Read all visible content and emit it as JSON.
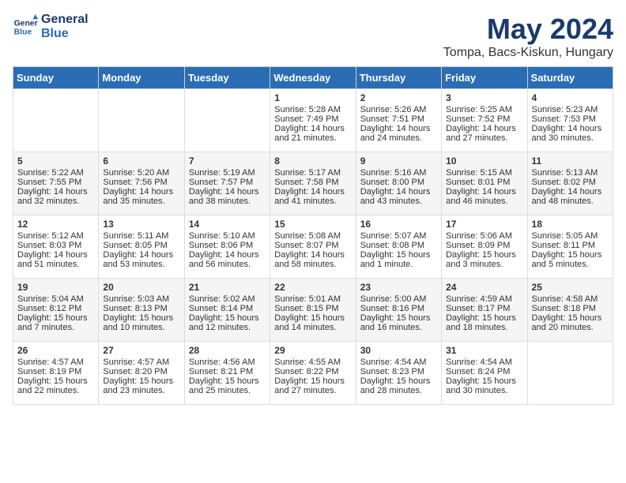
{
  "header": {
    "logo_line1": "General",
    "logo_line2": "Blue",
    "month_year": "May 2024",
    "location": "Tompa, Bacs-Kiskun, Hungary"
  },
  "days_of_week": [
    "Sunday",
    "Monday",
    "Tuesday",
    "Wednesday",
    "Thursday",
    "Friday",
    "Saturday"
  ],
  "weeks": [
    [
      {
        "day": "",
        "content": ""
      },
      {
        "day": "",
        "content": ""
      },
      {
        "day": "",
        "content": ""
      },
      {
        "day": "1",
        "content": "Sunrise: 5:28 AM\nSunset: 7:49 PM\nDaylight: 14 hours\nand 21 minutes."
      },
      {
        "day": "2",
        "content": "Sunrise: 5:26 AM\nSunset: 7:51 PM\nDaylight: 14 hours\nand 24 minutes."
      },
      {
        "day": "3",
        "content": "Sunrise: 5:25 AM\nSunset: 7:52 PM\nDaylight: 14 hours\nand 27 minutes."
      },
      {
        "day": "4",
        "content": "Sunrise: 5:23 AM\nSunset: 7:53 PM\nDaylight: 14 hours\nand 30 minutes."
      }
    ],
    [
      {
        "day": "5",
        "content": "Sunrise: 5:22 AM\nSunset: 7:55 PM\nDaylight: 14 hours\nand 32 minutes."
      },
      {
        "day": "6",
        "content": "Sunrise: 5:20 AM\nSunset: 7:56 PM\nDaylight: 14 hours\nand 35 minutes."
      },
      {
        "day": "7",
        "content": "Sunrise: 5:19 AM\nSunset: 7:57 PM\nDaylight: 14 hours\nand 38 minutes."
      },
      {
        "day": "8",
        "content": "Sunrise: 5:17 AM\nSunset: 7:58 PM\nDaylight: 14 hours\nand 41 minutes."
      },
      {
        "day": "9",
        "content": "Sunrise: 5:16 AM\nSunset: 8:00 PM\nDaylight: 14 hours\nand 43 minutes."
      },
      {
        "day": "10",
        "content": "Sunrise: 5:15 AM\nSunset: 8:01 PM\nDaylight: 14 hours\nand 46 minutes."
      },
      {
        "day": "11",
        "content": "Sunrise: 5:13 AM\nSunset: 8:02 PM\nDaylight: 14 hours\nand 48 minutes."
      }
    ],
    [
      {
        "day": "12",
        "content": "Sunrise: 5:12 AM\nSunset: 8:03 PM\nDaylight: 14 hours\nand 51 minutes."
      },
      {
        "day": "13",
        "content": "Sunrise: 5:11 AM\nSunset: 8:05 PM\nDaylight: 14 hours\nand 53 minutes."
      },
      {
        "day": "14",
        "content": "Sunrise: 5:10 AM\nSunset: 8:06 PM\nDaylight: 14 hours\nand 56 minutes."
      },
      {
        "day": "15",
        "content": "Sunrise: 5:08 AM\nSunset: 8:07 PM\nDaylight: 14 hours\nand 58 minutes."
      },
      {
        "day": "16",
        "content": "Sunrise: 5:07 AM\nSunset: 8:08 PM\nDaylight: 15 hours\nand 1 minute."
      },
      {
        "day": "17",
        "content": "Sunrise: 5:06 AM\nSunset: 8:09 PM\nDaylight: 15 hours\nand 3 minutes."
      },
      {
        "day": "18",
        "content": "Sunrise: 5:05 AM\nSunset: 8:11 PM\nDaylight: 15 hours\nand 5 minutes."
      }
    ],
    [
      {
        "day": "19",
        "content": "Sunrise: 5:04 AM\nSunset: 8:12 PM\nDaylight: 15 hours\nand 7 minutes."
      },
      {
        "day": "20",
        "content": "Sunrise: 5:03 AM\nSunset: 8:13 PM\nDaylight: 15 hours\nand 10 minutes."
      },
      {
        "day": "21",
        "content": "Sunrise: 5:02 AM\nSunset: 8:14 PM\nDaylight: 15 hours\nand 12 minutes."
      },
      {
        "day": "22",
        "content": "Sunrise: 5:01 AM\nSunset: 8:15 PM\nDaylight: 15 hours\nand 14 minutes."
      },
      {
        "day": "23",
        "content": "Sunrise: 5:00 AM\nSunset: 8:16 PM\nDaylight: 15 hours\nand 16 minutes."
      },
      {
        "day": "24",
        "content": "Sunrise: 4:59 AM\nSunset: 8:17 PM\nDaylight: 15 hours\nand 18 minutes."
      },
      {
        "day": "25",
        "content": "Sunrise: 4:58 AM\nSunset: 8:18 PM\nDaylight: 15 hours\nand 20 minutes."
      }
    ],
    [
      {
        "day": "26",
        "content": "Sunrise: 4:57 AM\nSunset: 8:19 PM\nDaylight: 15 hours\nand 22 minutes."
      },
      {
        "day": "27",
        "content": "Sunrise: 4:57 AM\nSunset: 8:20 PM\nDaylight: 15 hours\nand 23 minutes."
      },
      {
        "day": "28",
        "content": "Sunrise: 4:56 AM\nSunset: 8:21 PM\nDaylight: 15 hours\nand 25 minutes."
      },
      {
        "day": "29",
        "content": "Sunrise: 4:55 AM\nSunset: 8:22 PM\nDaylight: 15 hours\nand 27 minutes."
      },
      {
        "day": "30",
        "content": "Sunrise: 4:54 AM\nSunset: 8:23 PM\nDaylight: 15 hours\nand 28 minutes."
      },
      {
        "day": "31",
        "content": "Sunrise: 4:54 AM\nSunset: 8:24 PM\nDaylight: 15 hours\nand 30 minutes."
      },
      {
        "day": "",
        "content": ""
      }
    ]
  ]
}
